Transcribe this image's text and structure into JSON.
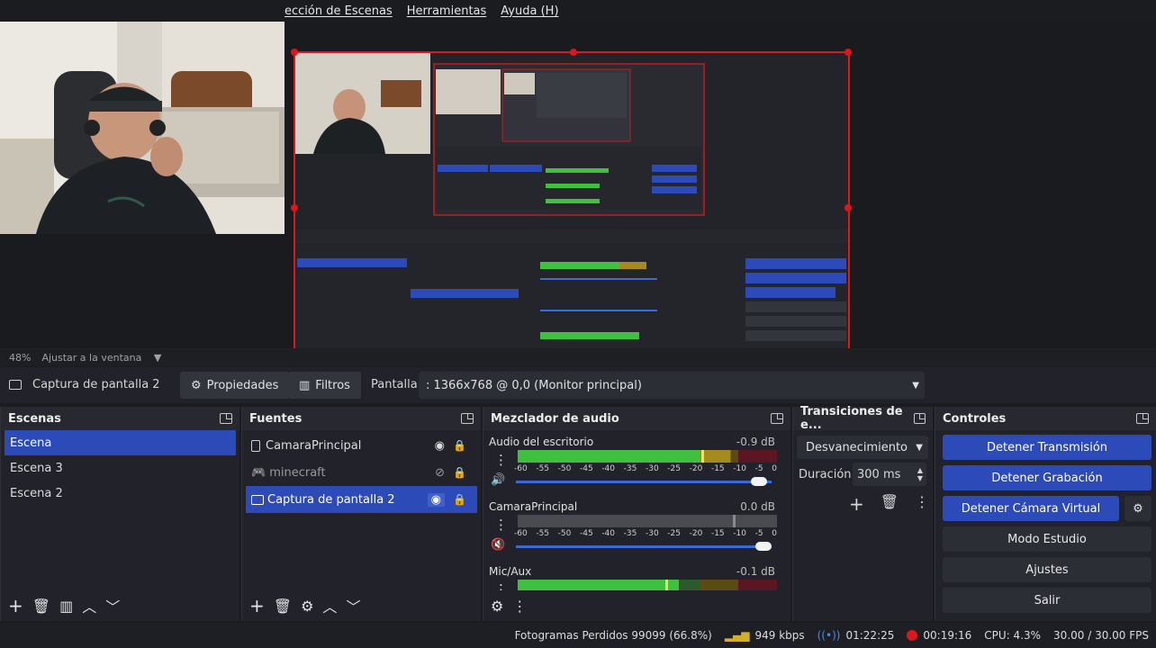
{
  "menu": {
    "items": [
      "ección de Escenas",
      "Herramientas",
      "Ayuda (H)"
    ]
  },
  "preview": {
    "zoom": "48%",
    "zoom_mode": "Ajustar a la ventana"
  },
  "source_toolbar": {
    "selected_source": "Captura de pantalla 2",
    "properties_label": "Propiedades",
    "filters_label": "Filtros",
    "display_label": "Pantalla",
    "display_value": ": 1366x768 @ 0,0 (Monitor principal)"
  },
  "scenes": {
    "title": "Escenas",
    "items": [
      "Escena",
      "Escena 3",
      "Escena 2"
    ]
  },
  "sources": {
    "title": "Fuentes",
    "items": [
      "CamaraPrincipal",
      "minecraft",
      "Captura de pantalla 2"
    ]
  },
  "mixer": {
    "title": "Mezclador de audio",
    "channels": [
      {
        "name": "Audio del escritorio",
        "db": "-0.9 dB",
        "level": 0.82,
        "peak": 0.71,
        "volume": 0.95
      },
      {
        "name": "CamaraPrincipal",
        "db": "0.0 dB",
        "level": 0.0,
        "peak": 0.83,
        "volume": 0.97
      },
      {
        "name": "Mic/Aux",
        "db": "-0.1 dB",
        "level": 0.62,
        "peak": 0.57,
        "volume": 0.95
      }
    ],
    "scale_labels": [
      "-60",
      "-55",
      "-50",
      "-45",
      "-40",
      "-35",
      "-30",
      "-25",
      "-20",
      "-15",
      "-10",
      "-5",
      "0"
    ]
  },
  "transitions": {
    "title": "Transiciones de e...",
    "type": "Desvanecimiento",
    "duration_label": "Duración",
    "duration_value": "300 ms"
  },
  "controls": {
    "title": "Controles",
    "stop_stream": "Detener Transmisión",
    "stop_record": "Detener Grabación",
    "stop_virtual_cam": "Detener Cámara Virtual",
    "studio_mode": "Modo Estudio",
    "settings": "Ajustes",
    "exit": "Salir"
  },
  "status": {
    "dropped_frames": "Fotogramas Perdidos 99099 (66.8%)",
    "bitrate": "949 kbps",
    "stream_time": "01:22:25",
    "rec_time": "00:19:16",
    "cpu": "CPU: 4.3%",
    "fps": "30.00 / 30.00 FPS"
  },
  "colors": {
    "accent": "#2d4bb8",
    "meter_green": "#3fc13f",
    "meter_yellow": "#a58a1e",
    "meter_red": "#a31829",
    "selection_red": "#d91b1b"
  }
}
